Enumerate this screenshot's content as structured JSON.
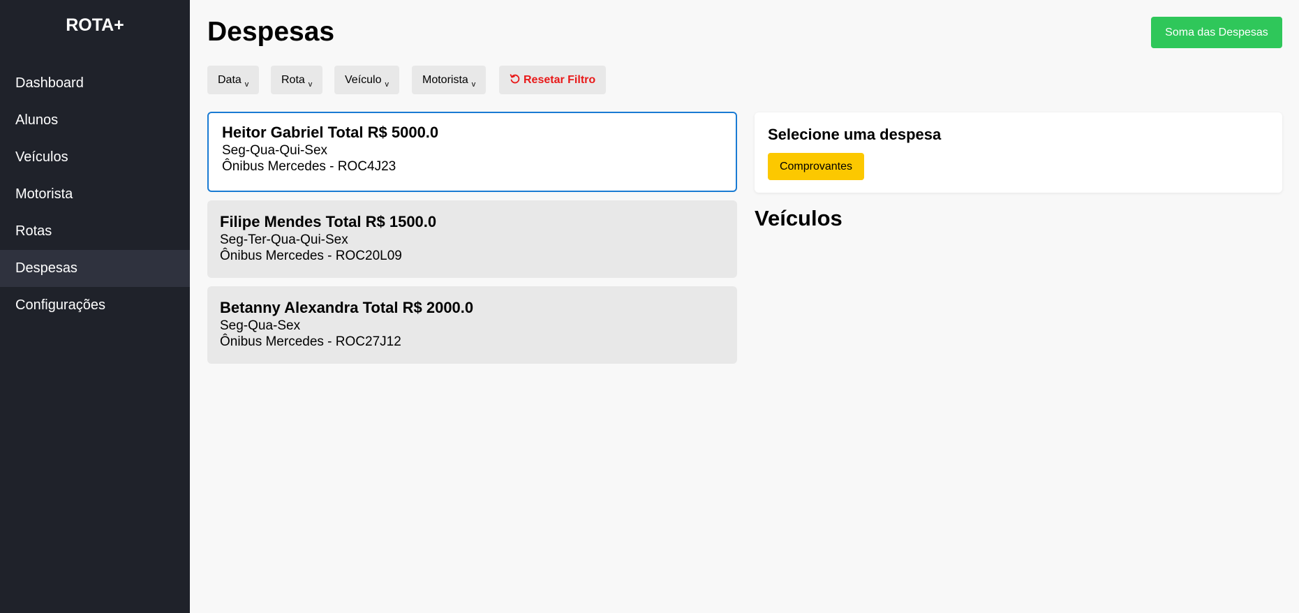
{
  "sidebar": {
    "brand": "ROTA+",
    "items": [
      {
        "label": "Dashboard"
      },
      {
        "label": "Alunos"
      },
      {
        "label": "Veículos"
      },
      {
        "label": "Motorista"
      },
      {
        "label": "Rotas"
      },
      {
        "label": "Despesas",
        "active": true
      },
      {
        "label": "Configurações"
      }
    ]
  },
  "header": {
    "title": "Despesas",
    "sum_button": "Soma das Despesas"
  },
  "filters": {
    "chevron": "v",
    "data": "Data",
    "rota": "Rota",
    "veiculo": "Veículo",
    "motorista": "Motorista",
    "reset": "Resetar Filtro",
    "reset_icon": "rotate-ccw-icon"
  },
  "expenses": [
    {
      "title": "Heitor Gabriel Total R$ 5000.0",
      "days": "Seg-Qua-Qui-Sex",
      "vehicle": "Ônibus Mercedes - ROC4J23",
      "selected": true
    },
    {
      "title": "Filipe Mendes Total R$ 1500.0",
      "days": "Seg-Ter-Qua-Qui-Sex",
      "vehicle": "Ônibus Mercedes - ROC20L09"
    },
    {
      "title": "Betanny Alexandra Total R$ 2000.0",
      "days": "Seg-Qua-Sex",
      "vehicle": "Ônibus Mercedes - ROC27J12"
    }
  ],
  "detail": {
    "title": "Selecione uma despesa",
    "button": "Comprovantes"
  },
  "vehicles_section": {
    "title": "Veículos"
  },
  "colors": {
    "sidebar_bg": "#1f222a",
    "sidebar_active": "#2f323e",
    "accent_green": "#2fc75a",
    "accent_yellow": "#fcc800",
    "reset_red": "#e81919",
    "selected_border": "#1a7bd3"
  }
}
